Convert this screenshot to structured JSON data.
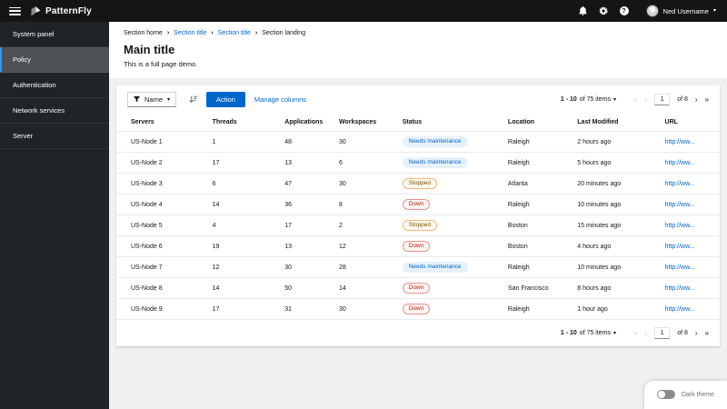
{
  "masthead": {
    "brand": "PatternFly",
    "user_name": "Ned Username",
    "help_glyph": "?"
  },
  "sidebar": {
    "items": [
      {
        "label": "System panel",
        "selected": false
      },
      {
        "label": "Policy",
        "selected": true
      },
      {
        "label": "Authentication",
        "selected": false
      },
      {
        "label": "Network services",
        "selected": false
      },
      {
        "label": "Server",
        "selected": false
      }
    ]
  },
  "breadcrumb": {
    "separator": "›",
    "items": [
      {
        "label": "Section home",
        "link": false
      },
      {
        "label": "Section title",
        "link": true
      },
      {
        "label": "Section title",
        "link": true
      },
      {
        "label": "Section landing",
        "link": false
      }
    ]
  },
  "page_header": {
    "title": "Main title",
    "subtitle": "This is a full page demo."
  },
  "toolbar": {
    "filter_label": "Name",
    "action_label": "Action",
    "manage_columns_label": "Manage columns"
  },
  "pagination": {
    "range_bold": "1 - 10",
    "range_rest": "of 75 items",
    "current_page": "1",
    "page_count_label": "of 8",
    "first_glyph": "«",
    "prev_glyph": "‹",
    "next_glyph": "›",
    "last_glyph": "»"
  },
  "table": {
    "columns": [
      {
        "key": "server",
        "label": "Servers"
      },
      {
        "key": "threads",
        "label": "Threads"
      },
      {
        "key": "applications",
        "label": "Applications"
      },
      {
        "key": "workspaces",
        "label": "Workspaces"
      },
      {
        "key": "status",
        "label": "Status"
      },
      {
        "key": "location",
        "label": "Location"
      },
      {
        "key": "modified",
        "label": "Last Modified"
      },
      {
        "key": "url",
        "label": "URL"
      }
    ],
    "rows": [
      {
        "server": "US-Node 1",
        "threads": "1",
        "applications": "48",
        "workspaces": "30",
        "status": "Needs maintenance",
        "status_type": "info",
        "location": "Raleigh",
        "modified": "2 hours ago",
        "url": "http://ww..."
      },
      {
        "server": "US-Node 2",
        "threads": "17",
        "applications": "13",
        "workspaces": "6",
        "status": "Needs maintenance",
        "status_type": "info",
        "location": "Raleigh",
        "modified": "5 hours ago",
        "url": "http://ww..."
      },
      {
        "server": "US-Node 3",
        "threads": "6",
        "applications": "47",
        "workspaces": "30",
        "status": "Stopped",
        "status_type": "warning",
        "location": "Atlanta",
        "modified": "20 minutes ago",
        "url": "http://ww..."
      },
      {
        "server": "US-Node 4",
        "threads": "14",
        "applications": "36",
        "workspaces": "8",
        "status": "Down",
        "status_type": "danger",
        "location": "Raleigh",
        "modified": "10 minutes ago",
        "url": "http://ww..."
      },
      {
        "server": "US-Node 5",
        "threads": "4",
        "applications": "17",
        "workspaces": "2",
        "status": "Stopped",
        "status_type": "warning",
        "location": "Boston",
        "modified": "15 minutes ago",
        "url": "http://ww..."
      },
      {
        "server": "US-Node 6",
        "threads": "19",
        "applications": "13",
        "workspaces": "12",
        "status": "Down",
        "status_type": "danger",
        "location": "Boston",
        "modified": "4 hours ago",
        "url": "http://ww..."
      },
      {
        "server": "US-Node 7",
        "threads": "12",
        "applications": "30",
        "workspaces": "28",
        "status": "Needs maintenance",
        "status_type": "info",
        "location": "Raleigh",
        "modified": "10 minutes ago",
        "url": "http://ww..."
      },
      {
        "server": "US-Node 8",
        "threads": "14",
        "applications": "50",
        "workspaces": "14",
        "status": "Down",
        "status_type": "danger",
        "location": "San Francisco",
        "modified": "8 hours ago",
        "url": "http://ww..."
      },
      {
        "server": "US-Node 9",
        "threads": "17",
        "applications": "31",
        "workspaces": "30",
        "status": "Down",
        "status_type": "danger",
        "location": "Raleigh",
        "modified": "1 hour ago",
        "url": "http://ww..."
      }
    ]
  },
  "theme_toggle": {
    "label": "Dark theme",
    "on": false
  },
  "colors": {
    "accent": "#0066cc",
    "masthead_bg": "#151515",
    "sidebar_bg": "#212427",
    "selected_indicator": "#2b9af3",
    "status_info_bg": "#e7f1fa",
    "status_info_text": "#0066cc",
    "status_warning_border": "#f4b678",
    "status_warning_text": "#795600",
    "status_danger_border": "#e8948a",
    "status_danger_text": "#c9190b"
  }
}
